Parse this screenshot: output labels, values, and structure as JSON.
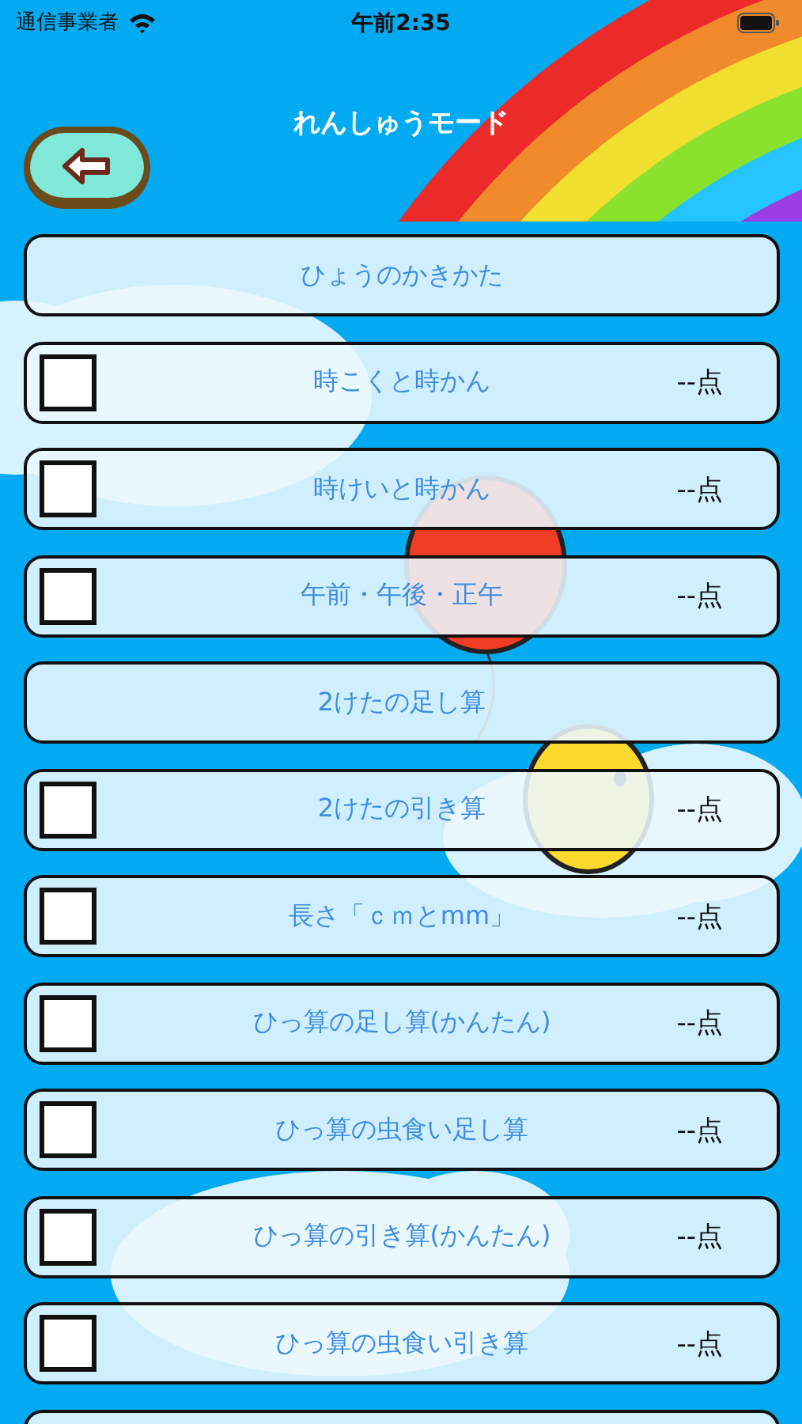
{
  "status_bar": {
    "carrier": "通信事業者",
    "time": "午前2:35"
  },
  "header": {
    "title": "れんしゅうモード"
  },
  "items": [
    {
      "kind": "header",
      "title": "ひょうのかきかた"
    },
    {
      "kind": "lesson",
      "title": "時こくと時かん",
      "checked": false,
      "score": "--点"
    },
    {
      "kind": "lesson",
      "title": "時けいと時かん",
      "checked": false,
      "score": "--点"
    },
    {
      "kind": "lesson",
      "title": "午前・午後・正午",
      "checked": false,
      "score": "--点"
    },
    {
      "kind": "header",
      "title": "2けたの足し算"
    },
    {
      "kind": "lesson",
      "title": "2けたの引き算",
      "checked": false,
      "score": "--点"
    },
    {
      "kind": "lesson",
      "title": "長さ「ｃｍとmm」",
      "checked": false,
      "score": "--点"
    },
    {
      "kind": "lesson",
      "title": "ひっ算の足し算(かんたん)",
      "checked": false,
      "score": "--点"
    },
    {
      "kind": "lesson",
      "title": "ひっ算の虫食い足し算",
      "checked": false,
      "score": "--点"
    },
    {
      "kind": "lesson",
      "title": "ひっ算の引き算(かんたん)",
      "checked": false,
      "score": "--点"
    },
    {
      "kind": "lesson",
      "title": "ひっ算の虫食い引き算",
      "checked": false,
      "score": "--点"
    },
    {
      "kind": "partial"
    }
  ]
}
